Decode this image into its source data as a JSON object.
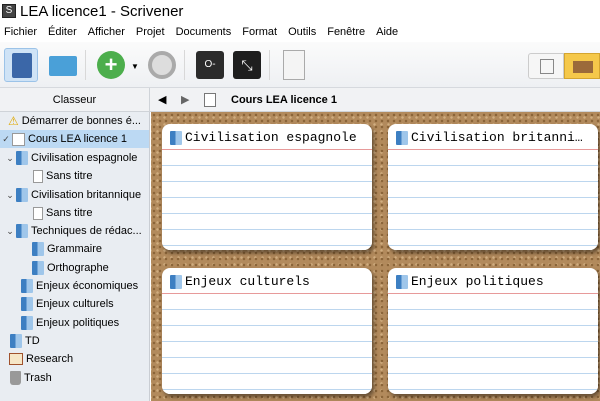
{
  "window": {
    "title": "LEA licence1 - Scrivener"
  },
  "menu": [
    "Fichier",
    "Éditer",
    "Afficher",
    "Projet",
    "Documents",
    "Format",
    "Outils",
    "Fenêtre",
    "Aide"
  ],
  "header": {
    "binder_label": "Classeur",
    "current_doc": "Cours LEA licence 1"
  },
  "binder": [
    {
      "label": "Démarrer de bonnes é...",
      "icon": "warning-icon",
      "level": 0
    },
    {
      "label": "Cours LEA licence 1",
      "icon": "corkboard-icon",
      "level": 0,
      "selected": true
    },
    {
      "label": "Civilisation espagnole",
      "icon": "folder-icon",
      "level": 1
    },
    {
      "label": "Sans titre",
      "icon": "document-icon",
      "level": 2
    },
    {
      "label": "Civilisation britannique",
      "icon": "folder-icon",
      "level": 1
    },
    {
      "label": "Sans titre",
      "icon": "document-icon",
      "level": 2
    },
    {
      "label": "Techniques de rédac...",
      "icon": "folder-icon",
      "level": 1
    },
    {
      "label": "Grammaire",
      "icon": "folder-icon",
      "level": 2
    },
    {
      "label": "Orthographe",
      "icon": "folder-icon",
      "level": 2
    },
    {
      "label": "Enjeux économiques",
      "icon": "folder-icon",
      "level": 1
    },
    {
      "label": "Enjeux culturels",
      "icon": "folder-icon",
      "level": 1
    },
    {
      "label": "Enjeux politiques",
      "icon": "folder-icon",
      "level": 1
    },
    {
      "label": "TD",
      "icon": "folder-icon",
      "level": 0
    },
    {
      "label": "Research",
      "icon": "research-icon",
      "level": 0
    },
    {
      "label": "Trash",
      "icon": "trash-icon",
      "level": 0
    }
  ],
  "cards": [
    {
      "title": "Civilisation espagnole"
    },
    {
      "title": "Civilisation britannique"
    },
    {
      "title": "Enjeux culturels"
    },
    {
      "title": "Enjeux politiques"
    }
  ]
}
